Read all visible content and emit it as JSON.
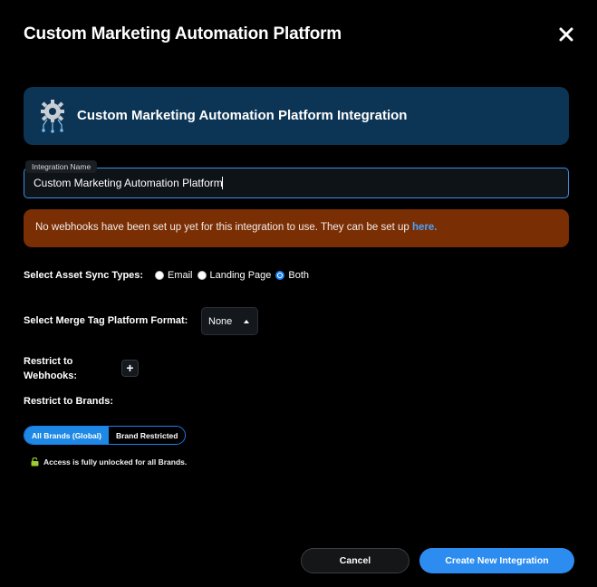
{
  "modal": {
    "title": "Custom Marketing Automation Platform"
  },
  "banner": {
    "title": "Custom Marketing Automation Platform Integration"
  },
  "integration_name": {
    "label": "Integration Name",
    "value": "Custom Marketing Automation Platform"
  },
  "warning": {
    "text": "No webhooks have been set up yet for this integration to use. They can be set up ",
    "link": "here."
  },
  "asset_sync": {
    "label": "Select Asset Sync Types:",
    "options": [
      "Email",
      "Landing Page",
      "Both"
    ],
    "selected": "Both"
  },
  "merge_tag": {
    "label": "Select Merge Tag Platform Format:",
    "value": "None"
  },
  "restrict_webhooks": {
    "label_line1": "Restrict to",
    "label_line2": "Webhooks:",
    "add_symbol": "+"
  },
  "restrict_brands": {
    "label": "Restrict to Brands:",
    "options": [
      "All Brands (Global)",
      "Brand Restricted"
    ],
    "selected": "All Brands (Global)",
    "status": "Access is fully unlocked for all Brands."
  },
  "footer": {
    "cancel_label": "Cancel",
    "create_label": "Create New Integration"
  },
  "colors": {
    "accent": "#2d8cf0",
    "banner": "#0b3455",
    "warning": "#7a2e04",
    "unlock_icon": "#9acd32"
  }
}
